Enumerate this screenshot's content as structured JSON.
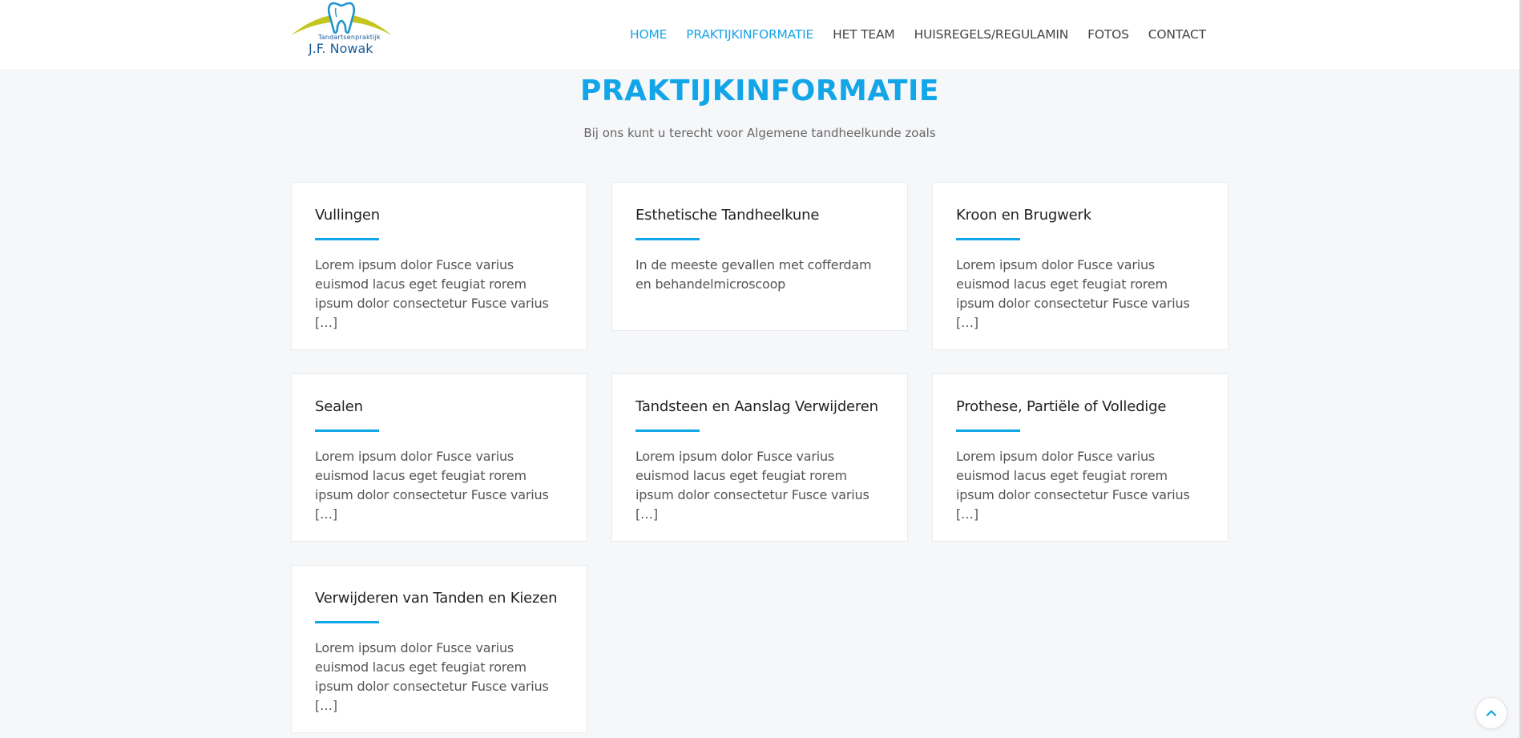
{
  "logo": {
    "subtitle": "Tandartsenpraktijk",
    "name": "J.F. Nowak"
  },
  "nav": {
    "items": [
      "HOME",
      "PRAKTIJKINFORMATIE",
      "HET TEAM",
      "HUISREGELS/REGULAMIN",
      "FOTOS",
      "CONTACT"
    ]
  },
  "colors": {
    "accent": "#12a5e8",
    "logo_arc": "#c4c51e",
    "logo_text": "#1a5a9a"
  },
  "page": {
    "title": "PRAKTIJKINFORMATIE",
    "subtitle": "Bij ons kunt u terecht voor Algemene tandheelkunde zoals"
  },
  "cards": [
    {
      "title": "Vullingen",
      "text": "Lorem ipsum dolor Fusce varius euismod lacus eget feugiat rorem ipsum dolor consectetur Fusce varius […]"
    },
    {
      "title": "Esthetische Tandheelkune",
      "text": "In de meeste gevallen met cofferdam en behandelmicroscoop"
    },
    {
      "title": "Kroon en Brugwerk",
      "text": "Lorem ipsum dolor Fusce varius euismod lacus eget feugiat rorem ipsum dolor consectetur Fusce varius […]"
    },
    {
      "title": "Sealen",
      "text": "Lorem ipsum dolor Fusce varius euismod lacus eget feugiat rorem ipsum dolor consectetur Fusce varius […]"
    },
    {
      "title": "Tandsteen en Aanslag Verwijderen",
      "text": "Lorem ipsum dolor Fusce varius euismod lacus eget feugiat rorem ipsum dolor consectetur Fusce varius […]"
    },
    {
      "title": "Prothese, Partiële of Volledige",
      "text": "Lorem ipsum dolor Fusce varius euismod lacus eget feugiat rorem ipsum dolor consectetur Fusce varius […]"
    },
    {
      "title": "Verwijderen van Tanden en Kiezen",
      "text": "Lorem ipsum dolor Fusce varius euismod lacus eget feugiat rorem ipsum dolor consectetur Fusce varius […]"
    }
  ],
  "icons": {
    "scroll_top": "chevron-up-icon",
    "logo": "tooth-icon"
  }
}
